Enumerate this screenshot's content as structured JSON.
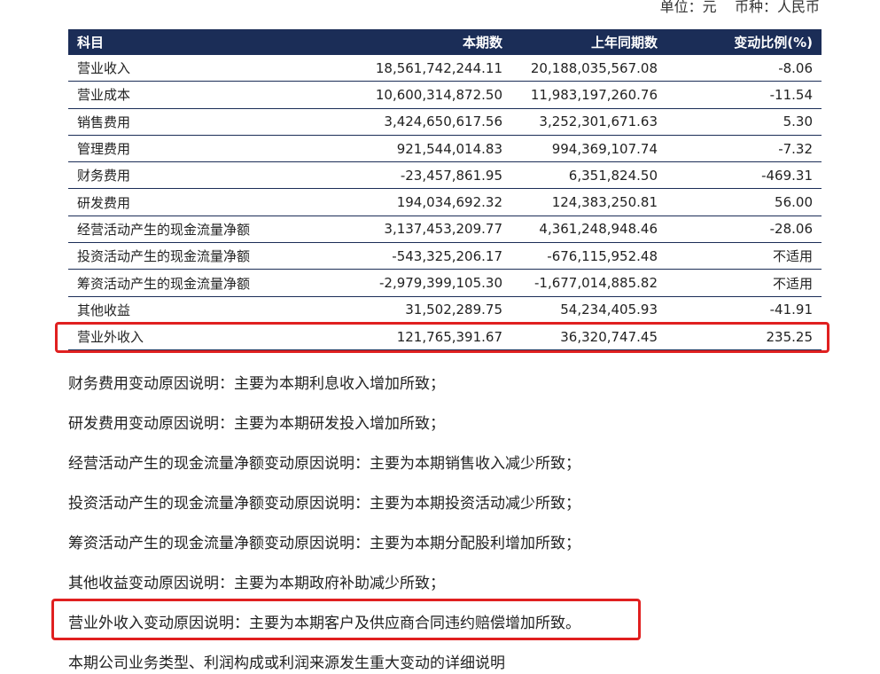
{
  "unit_line": "单位：元    币种：人民币",
  "table": {
    "headers": [
      "科目",
      "本期数",
      "上年同期数",
      "变动比例(%)"
    ],
    "rows": [
      [
        "营业收入",
        "18,561,742,244.11",
        "20,188,035,567.08",
        "-8.06"
      ],
      [
        "营业成本",
        "10,600,314,872.50",
        "11,983,197,260.76",
        "-11.54"
      ],
      [
        "销售费用",
        "3,424,650,617.56",
        "3,252,301,671.63",
        "5.30"
      ],
      [
        "管理费用",
        "921,544,014.83",
        "994,369,107.74",
        "-7.32"
      ],
      [
        "财务费用",
        "-23,457,861.95",
        "6,351,824.50",
        "-469.31"
      ],
      [
        "研发费用",
        "194,034,692.32",
        "124,383,250.81",
        "56.00"
      ],
      [
        "经营活动产生的现金流量净额",
        "3,137,453,209.77",
        "4,361,248,948.46",
        "-28.06"
      ],
      [
        "投资活动产生的现金流量净额",
        "-543,325,206.17",
        "-676,115,952.48",
        "不适用"
      ],
      [
        "筹资活动产生的现金流量净额",
        "-2,979,399,105.30",
        "-1,677,014,885.82",
        "不适用"
      ],
      [
        "其他收益",
        "31,502,289.75",
        "54,234,405.93",
        "-41.91"
      ],
      [
        "营业外收入",
        "121,765,391.67",
        "36,320,747.45",
        "235.25"
      ]
    ]
  },
  "notes": [
    "财务费用变动原因说明：主要为本期利息收入增加所致；",
    "研发费用变动原因说明：主要为本期研发投入增加所致；",
    "经营活动产生的现金流量净额变动原因说明：主要为本期销售收入减少所致；",
    "投资活动产生的现金流量净额变动原因说明：主要为本期投资活动减少所致；",
    "筹资活动产生的现金流量净额变动原因说明：主要为本期分配股利增加所致；",
    "其他收益变动原因说明：主要为本期政府补助减少所致；",
    "营业外收入变动原因说明：主要为本期客户及供应商合同违约赔偿增加所致。",
    "本期公司业务类型、利润构成或利润来源发生重大变动的详细说明"
  ],
  "colors": {
    "header_bg": "#1b2d57",
    "highlight": "#e02020"
  }
}
